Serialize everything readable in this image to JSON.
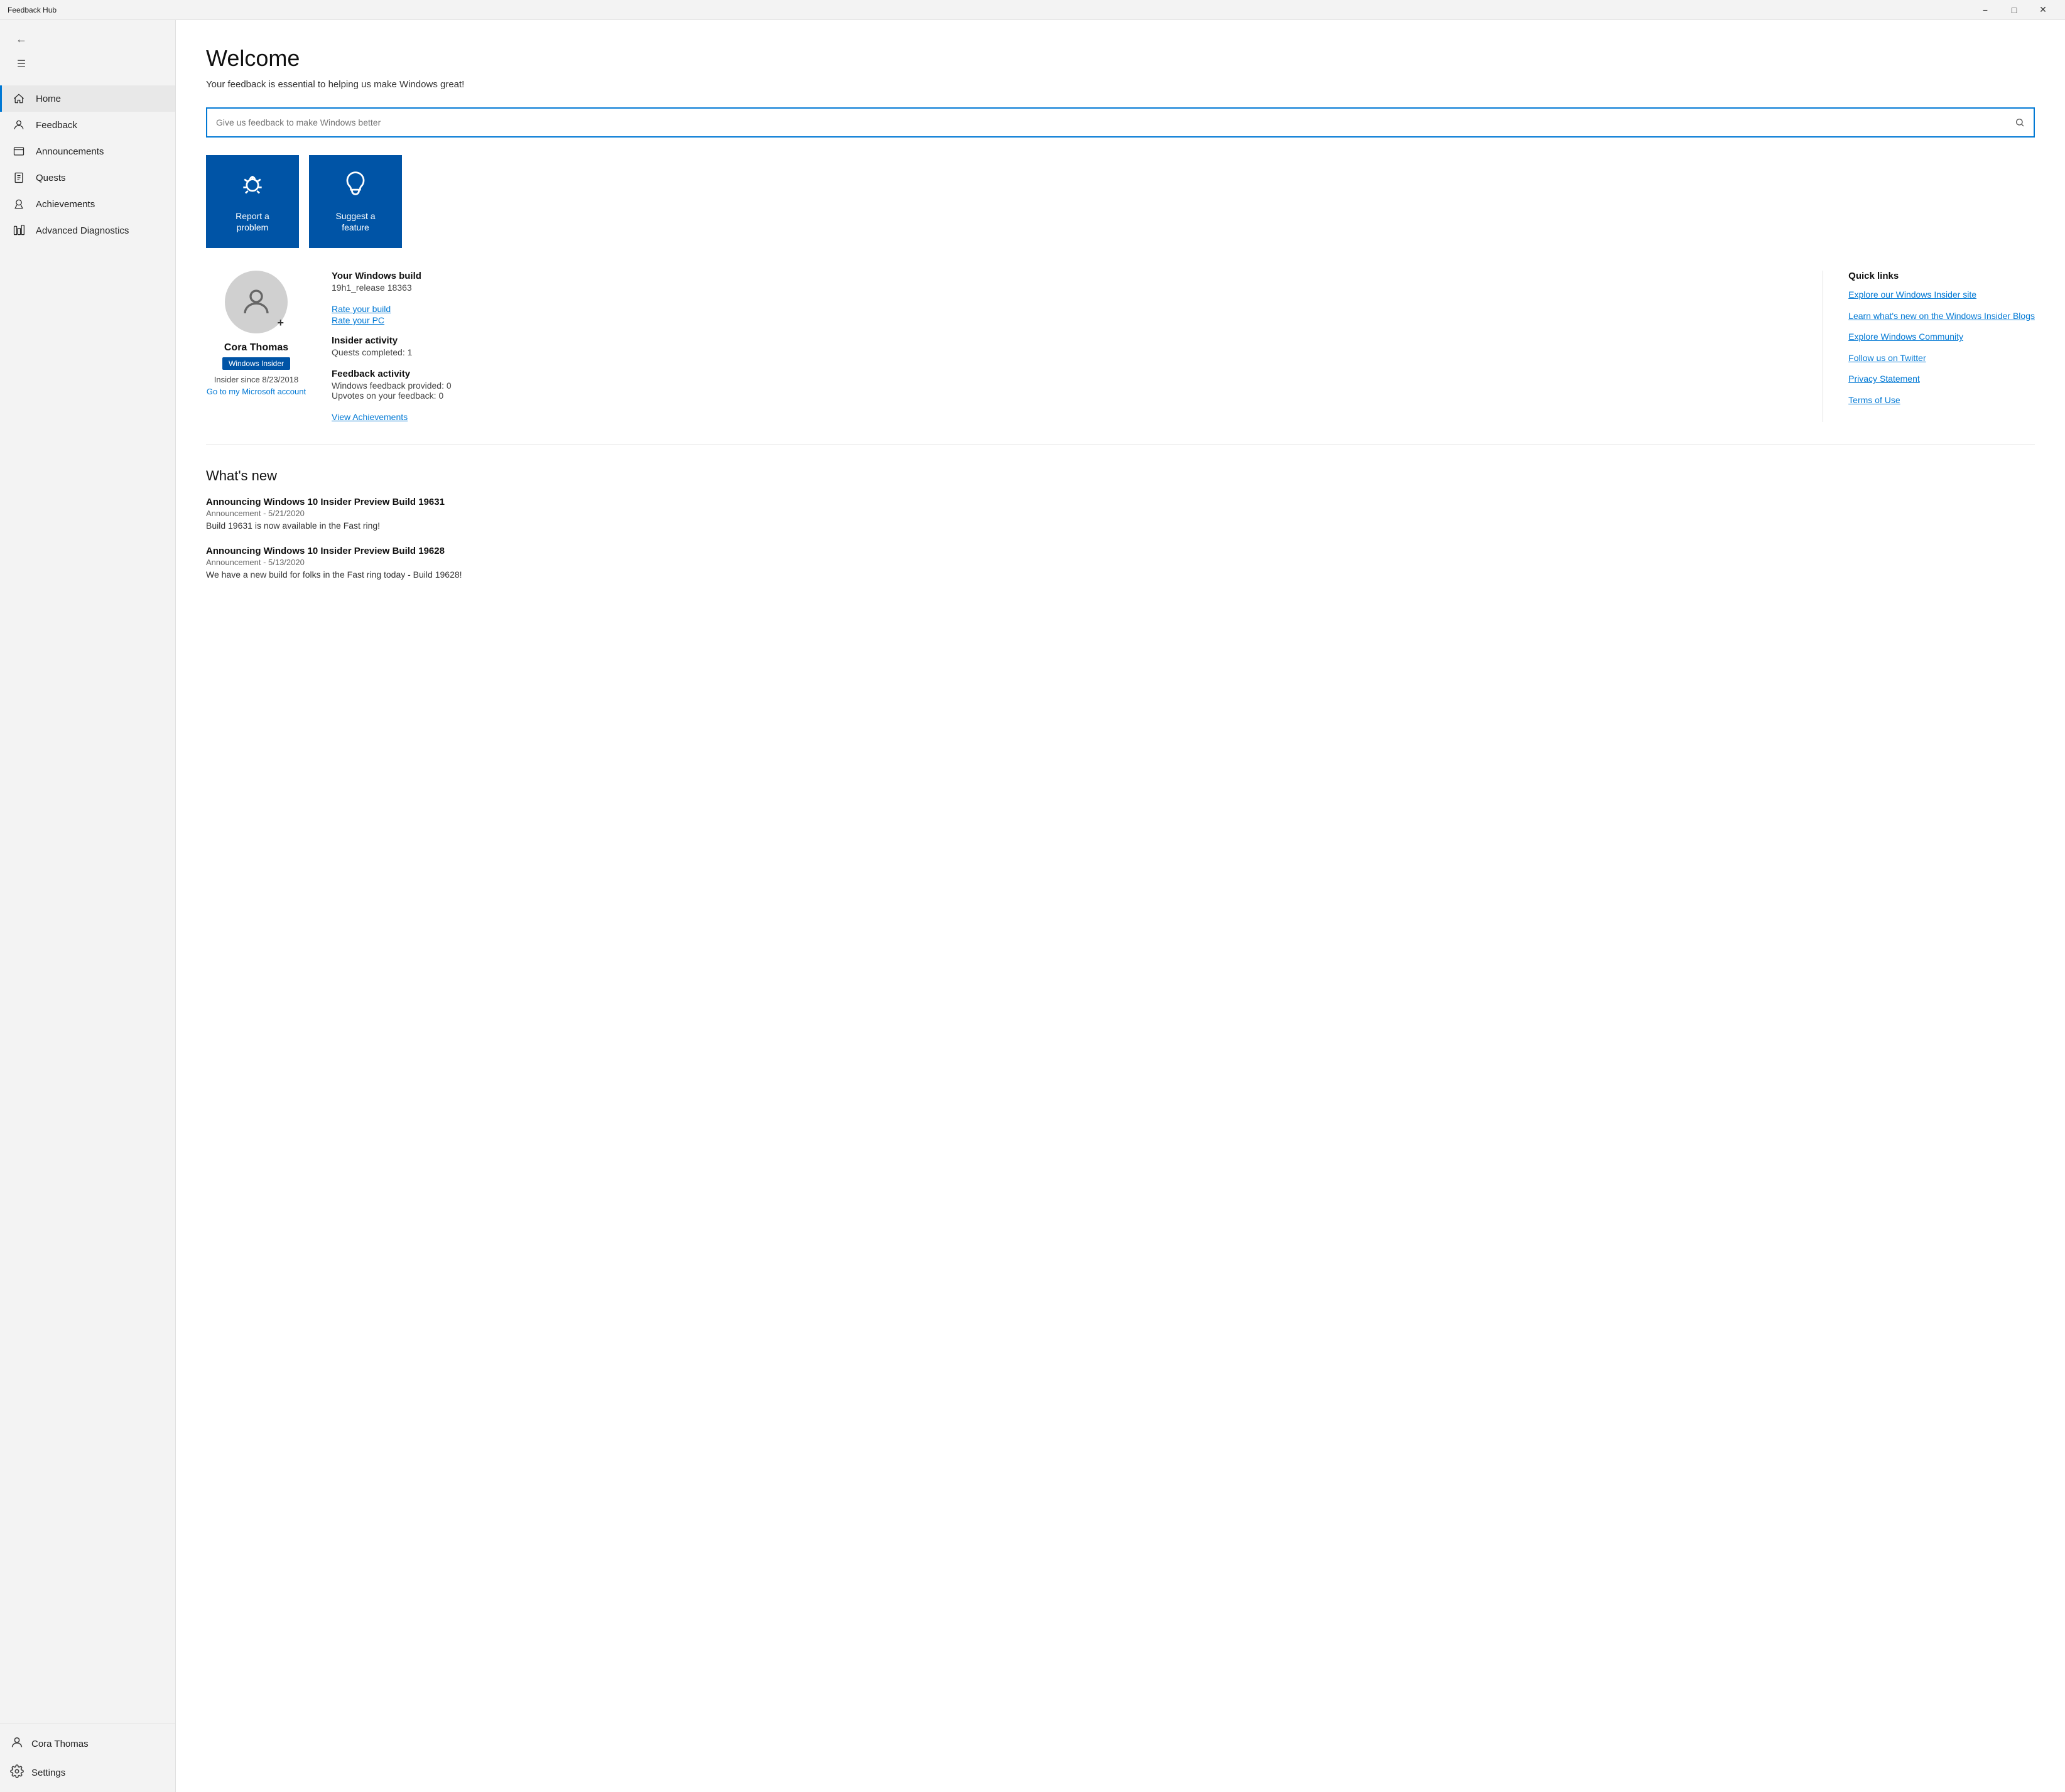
{
  "titleBar": {
    "appName": "Feedback Hub"
  },
  "sidebar": {
    "hamburgerLabel": "☰",
    "backLabel": "←",
    "navItems": [
      {
        "id": "home",
        "label": "Home",
        "icon": "🏠",
        "active": true
      },
      {
        "id": "feedback",
        "label": "Feedback",
        "icon": "👤",
        "active": false
      },
      {
        "id": "announcements",
        "label": "Announcements",
        "icon": "🔔",
        "active": false
      },
      {
        "id": "quests",
        "label": "Quests",
        "icon": "📋",
        "active": false
      },
      {
        "id": "achievements",
        "label": "Achievements",
        "icon": "🏅",
        "active": false
      },
      {
        "id": "advanced-diagnostics",
        "label": "Advanced Diagnostics",
        "icon": "⚙",
        "active": false
      }
    ],
    "bottomItems": {
      "userName": "Cora Thomas",
      "settingsLabel": "Settings"
    }
  },
  "main": {
    "welcomeTitle": "Welcome",
    "welcomeSubtitle": "Your feedback is essential to helping us make Windows great!",
    "searchPlaceholder": "Give us feedback to make Windows better",
    "actionTiles": [
      {
        "id": "report-problem",
        "label": "Report a problem",
        "icon": "🐛"
      },
      {
        "id": "suggest-feature",
        "label": "Suggest a feature",
        "icon": "💡"
      }
    ],
    "profile": {
      "name": "Cora Thomas",
      "badge": "Windows Insider",
      "since": "Insider since 8/23/2018",
      "accountLink": "Go to my Microsoft account",
      "windowsBuild": {
        "title": "Your Windows build",
        "value": "19h1_release 18363"
      },
      "rateYourBuild": "Rate your build",
      "rateYourPC": "Rate your PC",
      "insiderActivity": {
        "title": "Insider activity",
        "questsCompleted": "Quests completed: 1"
      },
      "feedbackActivity": {
        "title": "Feedback activity",
        "feedbackProvided": "Windows feedback provided: 0",
        "upvotes": "Upvotes on your feedback: 0"
      },
      "viewAchievements": "View Achievements"
    },
    "quickLinks": {
      "title": "Quick links",
      "items": [
        "Explore our Windows Insider site",
        "Learn what's new on the Windows Insider Blogs",
        "Explore Windows Community",
        "Follow us on Twitter",
        "Privacy Statement",
        "Terms of Use"
      ]
    },
    "whatsNew": {
      "title": "What's new",
      "items": [
        {
          "title": "Announcing Windows 10 Insider Preview Build 19631",
          "meta": "Announcement  -  5/21/2020",
          "desc": "Build 19631 is now available in the Fast ring!"
        },
        {
          "title": "Announcing Windows 10 Insider Preview Build 19628",
          "meta": "Announcement  -  5/13/2020",
          "desc": "We have a new build for folks in the Fast ring today - Build 19628!"
        }
      ]
    }
  }
}
